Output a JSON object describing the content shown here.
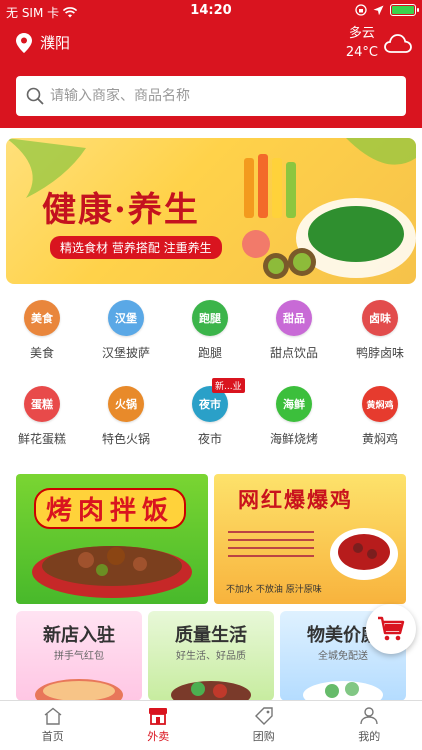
{
  "status_bar": {
    "carrier": "无 SIM 卡",
    "time": "14:20"
  },
  "header": {
    "city": "濮阳",
    "weather_condition": "多云",
    "temperature": "24°C",
    "search_placeholder": "请输入商家、商品名称"
  },
  "banner": {
    "title": "健康·养生",
    "subtitle": "精选食材 营养搭配 注重养生"
  },
  "categories": [
    {
      "icon_text": "美食",
      "label": "美食",
      "color": "#e9863c"
    },
    {
      "icon_text": "汉堡",
      "label": "汉堡披萨",
      "color": "#5aa8e6"
    },
    {
      "icon_text": "跑腿",
      "label": "跑腿",
      "color": "#3bb44a"
    },
    {
      "icon_text": "甜品",
      "label": "甜点饮品",
      "color": "#c86ad6"
    },
    {
      "icon_text": "卤味",
      "label": "鸭脖卤味",
      "color": "#e24c4c"
    },
    {
      "icon_text": "蛋糕",
      "label": "鲜花蛋糕",
      "color": "#e84a4a"
    },
    {
      "icon_text": "火锅",
      "label": "特色火锅",
      "color": "#e88a2a"
    },
    {
      "icon_text": "夜市",
      "label": "夜市",
      "color": "#2aa0c8",
      "badge": "新...业"
    },
    {
      "icon_text": "海鲜",
      "label": "海鲜烧烤",
      "color": "#3cbf3c"
    },
    {
      "icon_text": "黄焖鸡",
      "label": "黄焖鸡",
      "color": "#e63b2e"
    }
  ],
  "promos": {
    "left_title": "烤肉拌饭",
    "right_title": "网红爆爆鸡",
    "right_desc": "不加水 不放油 原汁原味"
  },
  "small_promos": [
    {
      "title": "新店入驻",
      "sub": "拼手气红包"
    },
    {
      "title": "质量生活",
      "sub": "好生活、好品质"
    },
    {
      "title": "物美价廉",
      "sub": "全城免配送"
    }
  ],
  "tabs": [
    {
      "label": "首页",
      "icon": "home-icon"
    },
    {
      "label": "外卖",
      "icon": "store-icon"
    },
    {
      "label": "团购",
      "icon": "tag-icon"
    },
    {
      "label": "我的",
      "icon": "user-icon"
    }
  ],
  "colors": {
    "brand": "#d9141f"
  }
}
